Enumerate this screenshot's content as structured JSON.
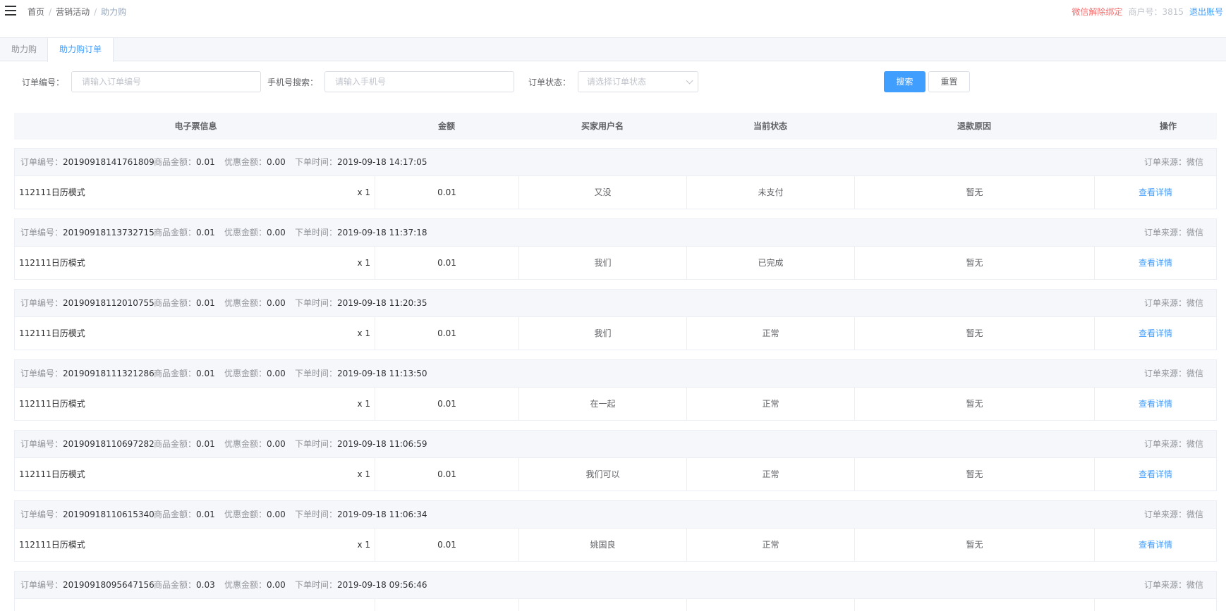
{
  "header": {
    "breadcrumb": [
      "首页",
      "营销活动",
      "助力购"
    ],
    "unbind_wechat": "微信解除绑定",
    "merchant_label": "商户号：3815",
    "logout": "退出账号"
  },
  "tabs": [
    {
      "label": "助力购",
      "active": false
    },
    {
      "label": "助力购订单",
      "active": true
    }
  ],
  "filters": {
    "order_no_label": "订单编号：",
    "order_no_placeholder": "请输入订单编号",
    "phone_label": "手机号搜索：",
    "phone_placeholder": "请输入手机号",
    "status_label": "订单状态：",
    "status_placeholder": "请选择订单状态",
    "search_button": "搜索",
    "reset_button": "重置"
  },
  "table": {
    "columns": [
      "电子票信息",
      "金额",
      "买家用户名",
      "当前状态",
      "退款原因",
      "操作"
    ],
    "labels": {
      "order_no": "订单编号：",
      "goods_amount": "商品金额：",
      "discount": "优惠金额：",
      "order_time": "下单时间：",
      "source": "订单来源：微信",
      "action": "查看详情"
    },
    "orders": [
      {
        "order_no": "20190918141761809",
        "goods_amount": "0.01",
        "discount": "0.00",
        "time": "2019-09-18 14:17:05",
        "product": "112111日历模式",
        "qty": "x 1",
        "amount": "0.01",
        "buyer": "又没",
        "status": "未支付",
        "refund": "暂无"
      },
      {
        "order_no": "20190918113732715",
        "goods_amount": "0.01",
        "discount": "0.00",
        "time": "2019-09-18 11:37:18",
        "product": "112111日历模式",
        "qty": "x 1",
        "amount": "0.01",
        "buyer": "我们",
        "status": "已完成",
        "refund": "暂无"
      },
      {
        "order_no": "20190918112010755",
        "goods_amount": "0.01",
        "discount": "0.00",
        "time": "2019-09-18 11:20:35",
        "product": "112111日历模式",
        "qty": "x 1",
        "amount": "0.01",
        "buyer": "我们",
        "status": "正常",
        "refund": "暂无"
      },
      {
        "order_no": "20190918111321286",
        "goods_amount": "0.01",
        "discount": "0.00",
        "time": "2019-09-18 11:13:50",
        "product": "112111日历模式",
        "qty": "x 1",
        "amount": "0.01",
        "buyer": "在一起",
        "status": "正常",
        "refund": "暂无"
      },
      {
        "order_no": "20190918110697282",
        "goods_amount": "0.01",
        "discount": "0.00",
        "time": "2019-09-18 11:06:59",
        "product": "112111日历模式",
        "qty": "x 1",
        "amount": "0.01",
        "buyer": "我们可以",
        "status": "正常",
        "refund": "暂无"
      },
      {
        "order_no": "20190918110615340",
        "goods_amount": "0.01",
        "discount": "0.00",
        "time": "2019-09-18 11:06:34",
        "product": "112111日历模式",
        "qty": "x 1",
        "amount": "0.01",
        "buyer": "姚国良",
        "status": "正常",
        "refund": "暂无"
      },
      {
        "order_no": "20190918095647156",
        "goods_amount": "0.03",
        "discount": "0.00",
        "time": "2019-09-18 09:56:46",
        "product": "",
        "qty": "",
        "amount": "",
        "buyer": "",
        "status": "",
        "refund": "",
        "hide_action": true
      }
    ]
  },
  "colors": {
    "primary": "#409eff",
    "danger": "#f56c6c",
    "header_bg": "#f5f7fa"
  }
}
